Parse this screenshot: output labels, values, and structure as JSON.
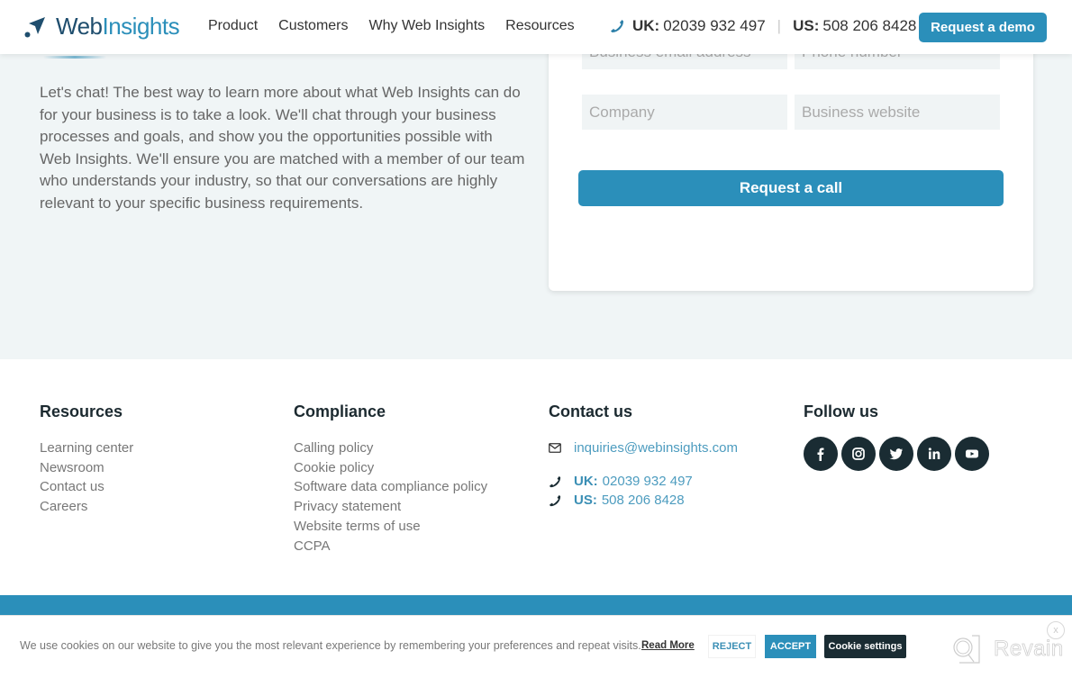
{
  "header": {
    "logo": {
      "bold": "Web",
      "light": "Insights"
    },
    "nav": [
      "Product",
      "Customers",
      "Why Web Insights",
      "Resources"
    ],
    "phones": {
      "uk_label": "UK:",
      "uk_number": "02039 932 497",
      "separator": "|",
      "us_label": "US:",
      "us_number": "508 206 8428"
    },
    "demo_button": "Request a demo"
  },
  "contact": {
    "intro": "Let's chat! The best way to learn more about what Web Insights can do for your business is to take a look. We'll chat through your business processes and goals, and show you the opportunities possible with Web Insights. We'll ensure you are matched with a member of our team who understands your industry, so that our conversations are highly relevant to your specific business requirements.",
    "form": {
      "email_placeholder": "Business email address",
      "phone_placeholder": "Phone number",
      "company_placeholder": "Company",
      "website_placeholder": "Business website",
      "submit": "Request a call"
    }
  },
  "footer": {
    "resources": {
      "title": "Resources",
      "links": [
        "Learning center",
        "Newsroom",
        "Contact us",
        "Careers"
      ]
    },
    "compliance": {
      "title": "Compliance",
      "links": [
        "Calling policy",
        "Cookie policy",
        "Software data compliance policy",
        "Privacy statement",
        "Website terms of use",
        "CCPA"
      ]
    },
    "contact": {
      "title": "Contact us",
      "email": "inquiries@webinsights.com",
      "uk_label": "UK:",
      "uk_number": "02039 932 497",
      "us_label": "US:",
      "us_number": "508 206 8428"
    },
    "follow": {
      "title": "Follow us",
      "icons": [
        "facebook-icon",
        "instagram-icon",
        "twitter-icon",
        "linkedin-icon",
        "youtube-icon"
      ]
    }
  },
  "cookie": {
    "text": "We use cookies on our website to give you the most relevant experience by remembering your preferences and repeat visits.",
    "read_more": "Read More",
    "reject": "REJECT",
    "accept": "ACCEPT",
    "settings": "Cookie settings"
  },
  "revain": {
    "label": "Revain",
    "close": "x"
  },
  "colors": {
    "brand": "#2b8fba",
    "dark": "#1a2c33",
    "bg": "#f0f5f6"
  }
}
